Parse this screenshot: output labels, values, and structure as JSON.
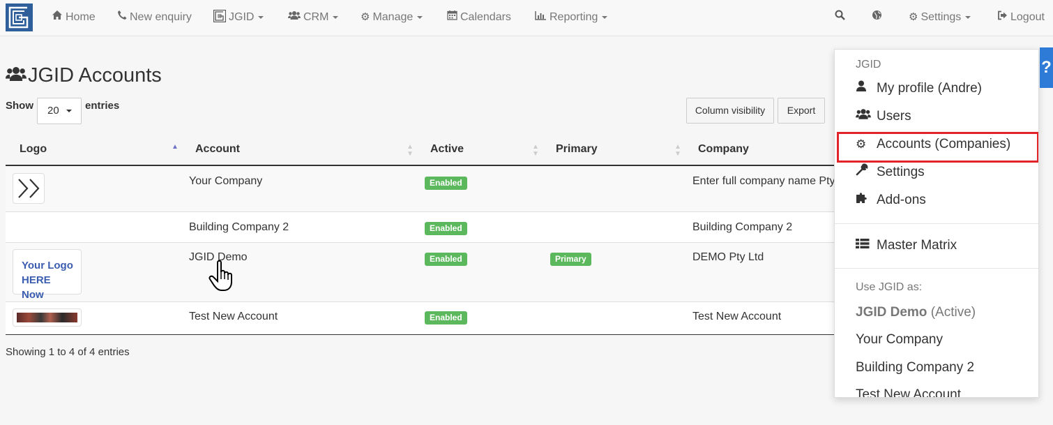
{
  "navbar": {
    "home": "Home",
    "new_enquiry": "New enquiry",
    "jgid": "JGID",
    "crm": "CRM",
    "manage": "Manage",
    "calendars": "Calendars",
    "reporting": "Reporting",
    "settings": "Settings",
    "logout": "Logout"
  },
  "page": {
    "title": "JGID Accounts",
    "show_label": "Show",
    "page_length": "20",
    "entries_label": "entries",
    "column_visibility": "Column visibility",
    "export": "Export",
    "info": "Showing 1 to 4 of 4 entries"
  },
  "table": {
    "headers": {
      "logo": "Logo",
      "account": "Account",
      "active": "Active",
      "primary": "Primary",
      "company": "Company"
    },
    "rows": [
      {
        "account": "Your Company",
        "active": "Enabled",
        "primary": "",
        "company": "Enter full company name Pty"
      },
      {
        "account": "Building Company 2",
        "active": "Enabled",
        "primary": "",
        "company": "Building Company 2"
      },
      {
        "account": "JGID Demo",
        "active": "Enabled",
        "primary": "Primary",
        "company": "DEMO Pty Ltd",
        "logo_text": "Your Logo HERE Now"
      },
      {
        "account": "Test New Account",
        "active": "Enabled",
        "primary": "",
        "company": "Test New Account"
      }
    ]
  },
  "dropdown": {
    "header": "JGID",
    "items": [
      {
        "label": "My profile (Andre)"
      },
      {
        "label": "Users"
      },
      {
        "label": "Accounts (Companies)"
      },
      {
        "label": "Settings"
      },
      {
        "label": "Add-ons"
      }
    ],
    "master_matrix": "Master Matrix",
    "use_as_header": "Use JGID as:",
    "active_account": "JGID Demo",
    "active_suffix": "(Active)",
    "accounts": [
      "Your Company",
      "Building Company 2",
      "Test New Account"
    ]
  },
  "help_tab": "?",
  "colors": {
    "brand": "#2f5f9a",
    "enabled": "#5cb85c",
    "highlight": "#e3232a",
    "help": "#2d7bd6"
  }
}
